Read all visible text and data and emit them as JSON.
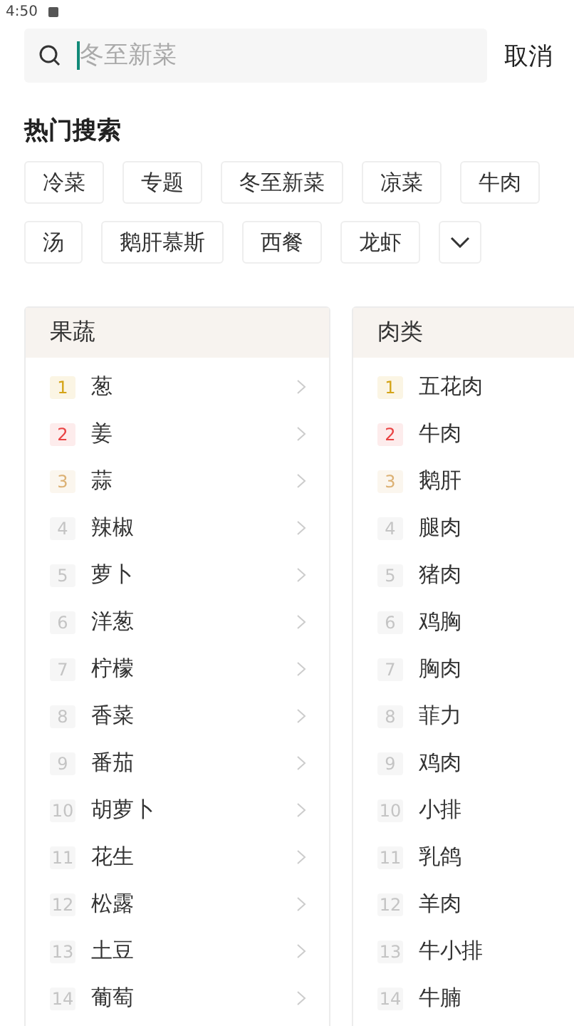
{
  "status_bar": {
    "time": "4:50"
  },
  "search": {
    "placeholder": "冬至新菜",
    "cancel": "取消"
  },
  "hot_search": {
    "title": "热门搜索",
    "tags": [
      "冷菜",
      "专题",
      "冬至新菜",
      "凉菜",
      "牛肉",
      "汤",
      "鹅肝慕斯",
      "西餐",
      "龙虾"
    ],
    "expanded": false
  },
  "categories": [
    {
      "title": "果蔬",
      "items": [
        {
          "rank": "1",
          "kind": "gold",
          "name": "葱"
        },
        {
          "rank": "2",
          "kind": "red",
          "name": "姜"
        },
        {
          "rank": "3",
          "kind": "tan",
          "name": "蒜"
        },
        {
          "rank": "4",
          "kind": "plain",
          "name": "辣椒"
        },
        {
          "rank": "5",
          "kind": "plain",
          "name": "萝卜"
        },
        {
          "rank": "6",
          "kind": "plain",
          "name": "洋葱"
        },
        {
          "rank": "7",
          "kind": "plain",
          "name": "柠檬"
        },
        {
          "rank": "8",
          "kind": "plain",
          "name": "香菜"
        },
        {
          "rank": "9",
          "kind": "plain",
          "name": "番茄"
        },
        {
          "rank": "10",
          "kind": "plain",
          "name": "胡萝卜"
        },
        {
          "rank": "11",
          "kind": "plain",
          "name": "花生"
        },
        {
          "rank": "12",
          "kind": "plain",
          "name": "松露"
        },
        {
          "rank": "13",
          "kind": "plain",
          "name": "土豆"
        },
        {
          "rank": "14",
          "kind": "plain",
          "name": "葡萄"
        }
      ]
    },
    {
      "title": "肉类",
      "items": [
        {
          "rank": "1",
          "kind": "gold",
          "name": "五花肉"
        },
        {
          "rank": "2",
          "kind": "red",
          "name": "牛肉"
        },
        {
          "rank": "3",
          "kind": "tan",
          "name": "鹅肝"
        },
        {
          "rank": "4",
          "kind": "plain",
          "name": "腿肉"
        },
        {
          "rank": "5",
          "kind": "plain",
          "name": "猪肉"
        },
        {
          "rank": "6",
          "kind": "plain",
          "name": "鸡胸"
        },
        {
          "rank": "7",
          "kind": "plain",
          "name": "胸肉"
        },
        {
          "rank": "8",
          "kind": "plain",
          "name": "菲力"
        },
        {
          "rank": "9",
          "kind": "plain",
          "name": "鸡肉"
        },
        {
          "rank": "10",
          "kind": "plain",
          "name": "小排"
        },
        {
          "rank": "11",
          "kind": "plain",
          "name": "乳鸽"
        },
        {
          "rank": "12",
          "kind": "plain",
          "name": "羊肉"
        },
        {
          "rank": "13",
          "kind": "plain",
          "name": "牛小排"
        },
        {
          "rank": "14",
          "kind": "plain",
          "name": "牛腩"
        }
      ]
    }
  ]
}
